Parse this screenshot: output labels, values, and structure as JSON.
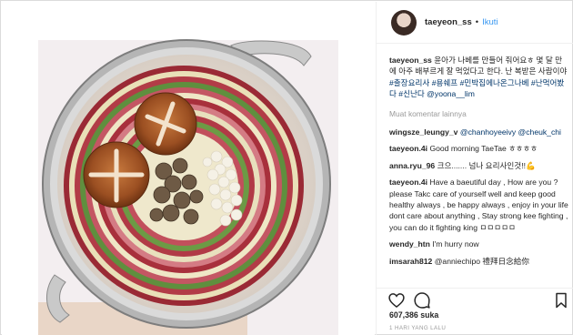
{
  "post": {
    "username": "taeyeon_ss",
    "follow_label": "Ikuti",
    "caption_user": "taeyeon_ss",
    "caption_text": "윤아가 나베를 만들어 줘어요ㅎ 몇 달 만에 아주 배부르게 잘 먹었다고 한다. 난 복받은 사람이야 ",
    "caption_tags": "#출장요리사 #용쉐프 #민박집에나온그나베 #난먹어봤다 #신난다 @yoona__lim",
    "more_comments_label": "Muat komentar lainnya"
  },
  "comments": [
    {
      "user": "wingsze_leungy_v",
      "text": "@chanhoyeeivy @cheuk_chi"
    },
    {
      "user": "taeyeon.4i",
      "text": "Good morning TaeTae ㅎㅎㅎㅎ"
    },
    {
      "user": "anna.ryu_96",
      "text": "크으....... 넘나 요리사인것!!💪"
    },
    {
      "user": "taeyeon.4i",
      "text": "Have a baeutiful day , How are you ? please Takc care of yourself well and keep good healthy always , be happy always , enjoy in your life dont care about anything , Stay strong kee fighting , you can do it fighting king ㅁㅁㅁㅁㅁ"
    },
    {
      "user": "wendy_htn",
      "text": "I'm hurry now"
    },
    {
      "user": "imsarah812",
      "text": "@anniechipo 禮拜日念給你"
    }
  ],
  "footer": {
    "likes": "607,386 suka",
    "time": "1 HARI YANG LALU"
  },
  "icons": {
    "heart": "heart-icon",
    "comment": "comment-icon",
    "bookmark": "bookmark-icon"
  },
  "colors": {
    "link": "#3897f0",
    "tag": "#003569",
    "muted": "#999999"
  }
}
